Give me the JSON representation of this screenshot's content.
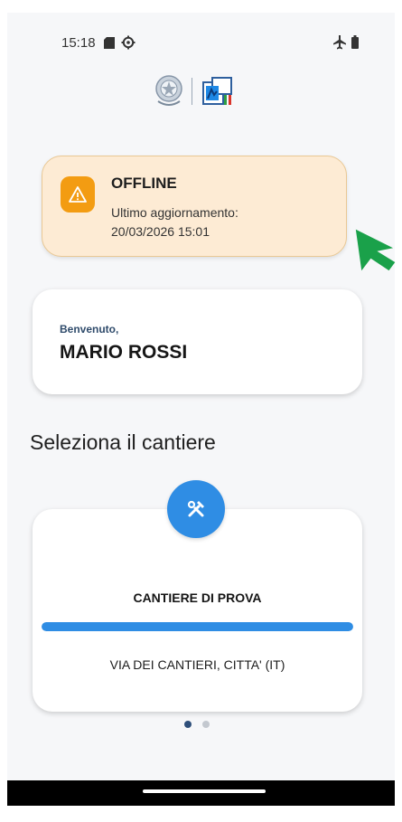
{
  "status_bar": {
    "time": "15:18",
    "icons": [
      "sd-card-icon",
      "gear-icon",
      "airplane-mode-icon",
      "battery-icon"
    ]
  },
  "header": {
    "logos": [
      "italian-republic-emblem",
      "app-brand-logo"
    ]
  },
  "offline_banner": {
    "icon": "warning-icon",
    "title": "OFFLINE",
    "last_update_label": "Ultimo aggiornamento:",
    "last_update_value": "20/03/2026 15:01",
    "colors": {
      "background": "#fdebd4",
      "border": "#e9c894",
      "icon_bg": "#f39c12"
    }
  },
  "welcome": {
    "greeting": "Benvenuto,",
    "user_name": "MARIO ROSSI"
  },
  "site_selection": {
    "title": "Seleziona il cantiere",
    "sites": [
      {
        "icon": "tools-icon",
        "name": "CANTIERE DI PROVA",
        "progress": 1.0,
        "address": "VIA DEI CANTIERI, CITTA' (IT)"
      }
    ],
    "pagination": {
      "current": 1,
      "total": 2
    }
  },
  "colors": {
    "accent": "#2f8de4",
    "dark_blue": "#2e4f7a",
    "cursor": "#1aa14a"
  }
}
